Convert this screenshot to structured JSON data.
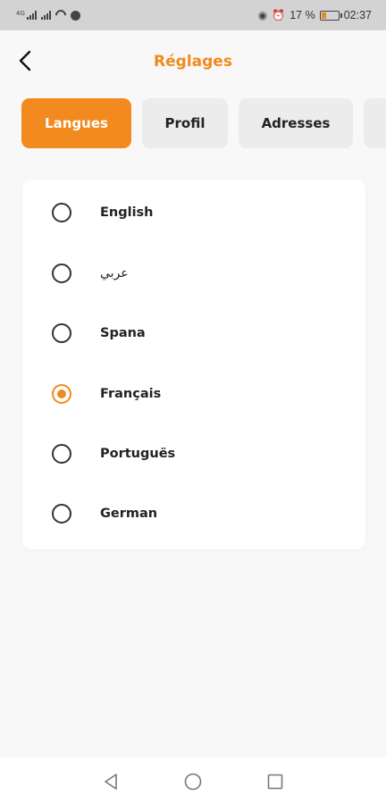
{
  "status_bar": {
    "battery_percent": "17 %",
    "time": "02:37",
    "signal_tag": "4G"
  },
  "header": {
    "title": "Réglages"
  },
  "tabs": [
    {
      "label": "Langues",
      "active": true
    },
    {
      "label": "Profil",
      "active": false
    },
    {
      "label": "Adresses",
      "active": false
    },
    {
      "label": "",
      "active": false
    }
  ],
  "languages": [
    {
      "label": "English",
      "selected": false
    },
    {
      "label": "عربي",
      "selected": false
    },
    {
      "label": "Spana",
      "selected": false
    },
    {
      "label": "Français",
      "selected": true
    },
    {
      "label": "Portuguës",
      "selected": false
    },
    {
      "label": "German",
      "selected": false
    }
  ],
  "colors": {
    "accent": "#f28a1f",
    "title": "#f08a1e",
    "background": "#f8f8f8"
  }
}
